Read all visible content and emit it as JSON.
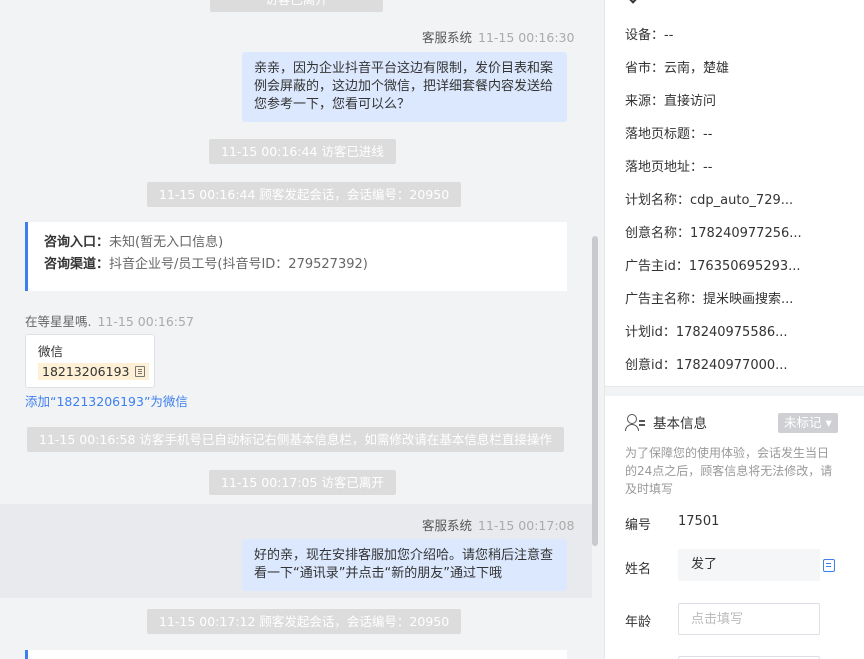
{
  "chat": {
    "top_pill": "访客已离开",
    "msg1": {
      "agent": "客服系统",
      "time": "11-15 00:16:30",
      "text": "亲亲，因为企业抖音平台这边有限制，发价目表和案例会屏蔽的，这边加个微信，把详细套餐内容发送给您参考一下，您看可以么？"
    },
    "sys1": "11-15 00:16:44 访客已进线",
    "sys2": "11-15 00:16:44 顾客发起会话，会话编号：20950",
    "card": {
      "entry_label": "咨询入口：",
      "entry_value": "未知(暂无入口信息)",
      "channel_label": "咨询渠道：",
      "channel_value": "抖音企业号/员工号(抖音号ID：279527392)"
    },
    "visitor": {
      "name": "在等星星嗎.",
      "time": "11-15 00:16:57",
      "wx_label": "微信",
      "wx_number": "18213206193",
      "add_link": "添加“18213206193”为微信"
    },
    "sys3": "11-15 00:16:58 访客手机号已自动标记右侧基本信息栏，如需修改请在基本信息栏直接操作",
    "sys4": "11-15 00:17:05 访客已离开",
    "msg2": {
      "agent": "客服系统",
      "time": "11-15 00:17:08",
      "text": "好的亲，现在安排客服加您介绍哈。请您稍后注意查看一下“通讯录”并点击“新的朋友”通过下哦"
    },
    "sys5": "11-15 00:17:12 顾客发起会话，会话编号：20950"
  },
  "side": {
    "info": [
      {
        "label": "设备：",
        "value": "--"
      },
      {
        "label": "省市：",
        "value": "云南，楚雄"
      },
      {
        "label": "来源：",
        "value": "直接访问"
      },
      {
        "label": "落地页标题：",
        "value": "--"
      },
      {
        "label": "落地页地址：",
        "value": "--"
      },
      {
        "label": "计划名称：",
        "value": "cdp_auto_729..."
      },
      {
        "label": "创意名称：",
        "value": "178240977256..."
      },
      {
        "label": "广告主id：",
        "value": "176350695293..."
      },
      {
        "label": "广告主名称：",
        "value": "提米映画搜索..."
      },
      {
        "label": "计划id：",
        "value": "178240975586..."
      },
      {
        "label": "创意id：",
        "value": "178240977000..."
      }
    ],
    "section_title": "基本信息",
    "tag_button": "未标记",
    "notice": "为了保障您的使用体验，会话发生当日的24点之后，顾客信息将无法修改，请及时填写",
    "id_label": "编号",
    "id_value": "17501",
    "name_label": "姓名",
    "name_value": "发了",
    "age_label": "年龄",
    "age_placeholder": "点击填写"
  }
}
